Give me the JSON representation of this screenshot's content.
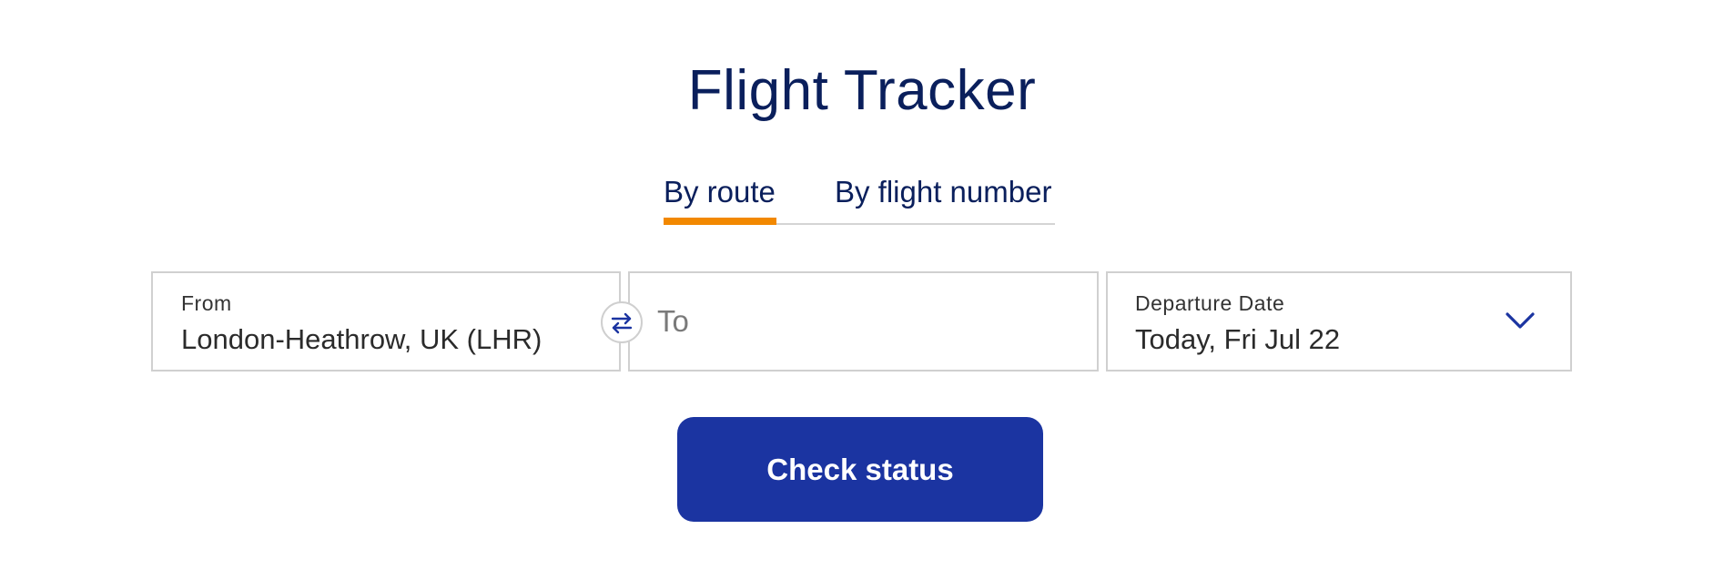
{
  "header": {
    "title": "Flight Tracker"
  },
  "tabs": [
    {
      "label": "By route",
      "active": true
    },
    {
      "label": "By flight number",
      "active": false
    }
  ],
  "form": {
    "from": {
      "label": "From",
      "value": "London-Heathrow, UK (LHR)"
    },
    "to": {
      "placeholder": "To",
      "value": ""
    },
    "departure": {
      "label": "Departure Date",
      "value": "Today, Fri Jul 22"
    },
    "swap_icon": "swap-arrows-icon",
    "dropdown_icon": "chevron-down-icon"
  },
  "actions": {
    "check_status_label": "Check status"
  },
  "colors": {
    "primary": "#1b34a1",
    "title": "#0a1f5c",
    "tab_indicator": "#f28800",
    "border": "#d0d0d0"
  }
}
